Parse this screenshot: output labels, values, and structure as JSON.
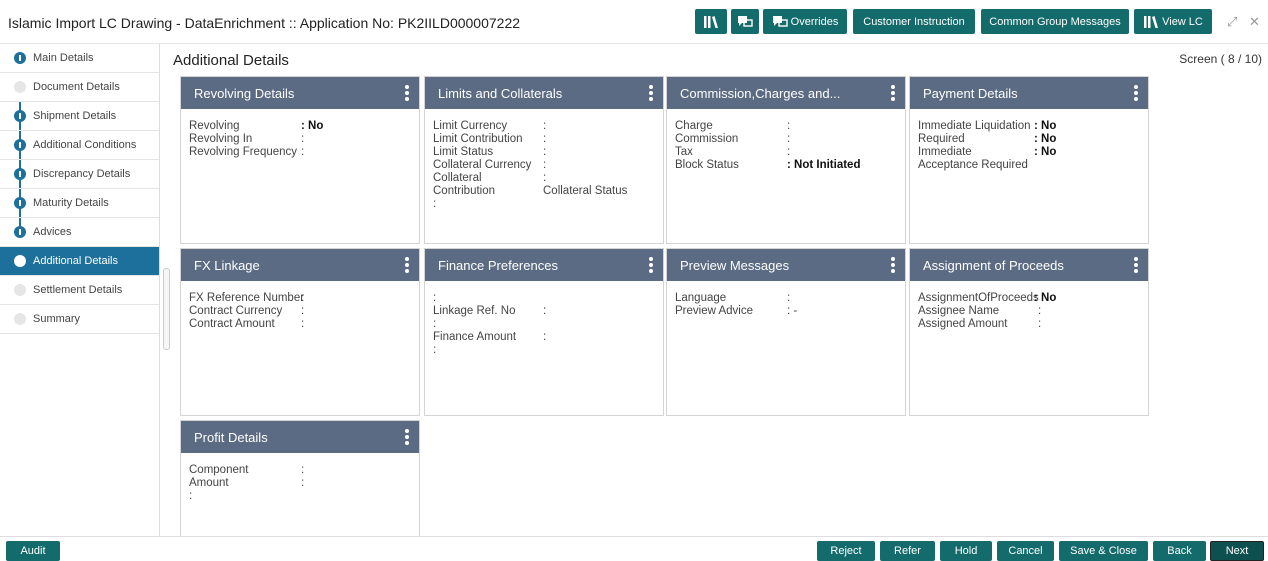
{
  "header": {
    "title": "Islamic Import LC Drawing - DataEnrichment :: Application No: PK2IILD000007222",
    "buttons": {
      "overrides": "Overrides",
      "customer_instruction": "Customer Instruction",
      "common_group_messages": "Common Group Messages",
      "view_lc": "View LC"
    },
    "window_controls": {
      "restore": "⤢",
      "close": "✕"
    }
  },
  "sidebar": {
    "items": [
      {
        "label": "Main Details",
        "state": "done"
      },
      {
        "label": "Document Details",
        "state": "pending"
      },
      {
        "label": "Shipment Details",
        "state": "done"
      },
      {
        "label": "Additional Conditions",
        "state": "done"
      },
      {
        "label": "Discrepancy Details",
        "state": "done"
      },
      {
        "label": "Maturity Details",
        "state": "done"
      },
      {
        "label": "Advices",
        "state": "done"
      },
      {
        "label": "Additional Details",
        "state": "active"
      },
      {
        "label": "Settlement Details",
        "state": "pending"
      },
      {
        "label": "Summary",
        "state": "pending"
      }
    ]
  },
  "main": {
    "title": "Additional Details",
    "screen_indicator": "Screen ( 8 / 10)"
  },
  "cards": {
    "revolving": {
      "title": "Revolving Details",
      "rows": [
        {
          "key": "Revolving",
          "value": ": No"
        },
        {
          "key": "Revolving In",
          "colon": ":"
        },
        {
          "key": "Revolving Frequency",
          "colon": ":"
        }
      ]
    },
    "limits": {
      "title": "Limits and Collaterals",
      "rows": [
        {
          "key": "Limit Currency",
          "colon": ":"
        },
        {
          "key": "Limit Contribution",
          "colon": ":"
        },
        {
          "key": "Limit Status",
          "colon": ":"
        },
        {
          "key": "Collateral Currency",
          "colon": ":"
        },
        {
          "key": "Collateral",
          "colon": ":"
        },
        {
          "key": "Contribution",
          "extra": "Collateral Status"
        },
        {
          "key": ":"
        }
      ]
    },
    "commission": {
      "title": "Commission,Charges and...",
      "rows": [
        {
          "key": "Charge",
          "colon": ":"
        },
        {
          "key": "Commission",
          "colon": ":"
        },
        {
          "key": "Tax",
          "colon": ":"
        },
        {
          "key": "Block Status",
          "value": ": Not Initiated"
        }
      ]
    },
    "payment": {
      "title": "Payment Details",
      "rows": [
        {
          "key": "Immediate Liquidation",
          "value": ": No"
        },
        {
          "key": "Required",
          "value": ": No"
        },
        {
          "key": "Immediate",
          "value": ": No"
        },
        {
          "key": "Acceptance Required"
        }
      ]
    },
    "fx": {
      "title": "FX Linkage",
      "rows": [
        {
          "key": "FX Reference Number",
          "colon": ":"
        },
        {
          "key": "Contract Currency",
          "colon": ":"
        },
        {
          "key": "Contract Amount",
          "colon": ":"
        }
      ]
    },
    "finance": {
      "title": "Finance Preferences",
      "rows": [
        {
          "key": ":"
        },
        {
          "key": "Linkage Ref. No",
          "colon": ":"
        },
        {
          "key": ":"
        },
        {
          "key": "Finance Amount",
          "colon": ":"
        },
        {
          "key": ":"
        }
      ]
    },
    "preview": {
      "title": "Preview Messages",
      "rows": [
        {
          "key": "Language",
          "colon": ":"
        },
        {
          "key": "Preview Advice",
          "colon": ": -"
        }
      ]
    },
    "assignment": {
      "title": "Assignment of Proceeds",
      "rows": [
        {
          "key": "AssignmentOfProceeds",
          "value": ": No"
        },
        {
          "key": "Assignee Name",
          "colon": ":"
        },
        {
          "key": "Assigned Amount",
          "colon": ":"
        }
      ]
    },
    "profit": {
      "title": "Profit Details",
      "rows": [
        {
          "key": "Component",
          "colon": ":"
        },
        {
          "key": "Amount",
          "colon": ":"
        },
        {
          "key": ":"
        }
      ]
    }
  },
  "footer": {
    "audit": "Audit",
    "reject": "Reject",
    "refer": "Refer",
    "hold": "Hold",
    "cancel": "Cancel",
    "save_close": "Save & Close",
    "back": "Back",
    "next": "Next"
  },
  "colors": {
    "primary_button": "#146b6b",
    "card_header": "#5a6b83",
    "sidebar_active": "#1d6f9c"
  }
}
